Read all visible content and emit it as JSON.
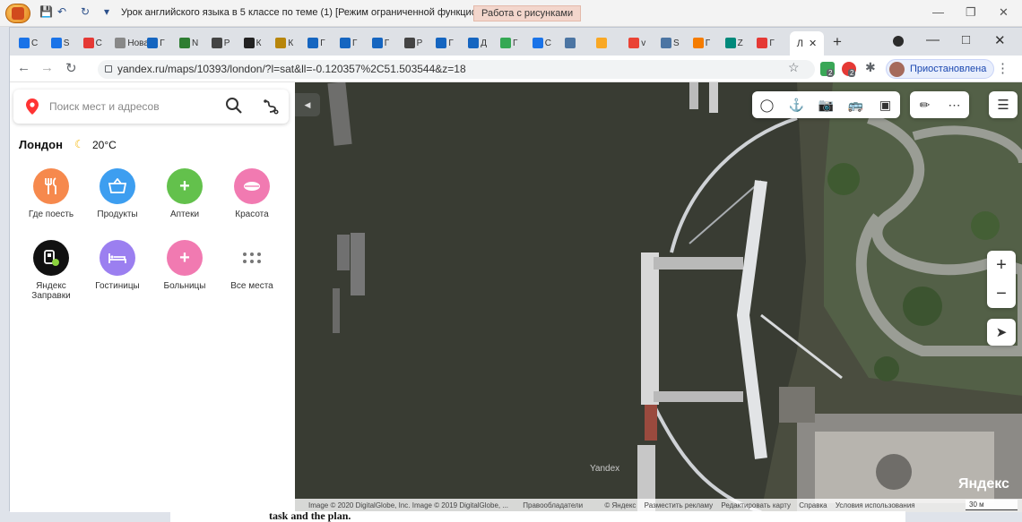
{
  "word": {
    "title": "Урок английского языка в 5 классе по теме (1) [Режим ограниченной функциона...",
    "context_tab": "Работа с рисунками",
    "doc_snippet": "task and the plan."
  },
  "browser": {
    "tabs": [
      {
        "letter": "С",
        "icon": "star-icon",
        "color": "#1a73e8"
      },
      {
        "letter": "S",
        "icon": "check-icon",
        "color": "#1a73e8"
      },
      {
        "letter": "С",
        "icon": "wheel-icon",
        "color": "#e53935"
      },
      {
        "letter": "Нова",
        "icon": "doc-icon",
        "color": "#888888"
      },
      {
        "letter": "Г",
        "icon": "mail-icon",
        "color": "#1565c0"
      },
      {
        "letter": "N",
        "icon": "eye-icon",
        "color": "#2e7d32"
      },
      {
        "letter": "Р",
        "icon": "gear-icon",
        "color": "#444444"
      },
      {
        "letter": "К",
        "icon": "wolf-icon",
        "color": "#222222"
      },
      {
        "letter": "К",
        "icon": "temple-icon",
        "color": "#b8860b"
      },
      {
        "letter": "Г",
        "icon": "p-icon",
        "color": "#1565c0"
      },
      {
        "letter": "Г",
        "icon": "mail-icon",
        "color": "#1565c0"
      },
      {
        "letter": "Г",
        "icon": "mail-icon",
        "color": "#1565c0"
      },
      {
        "letter": "Р",
        "icon": "gear-icon",
        "color": "#444444"
      },
      {
        "letter": "Г",
        "icon": "mail-icon",
        "color": "#1565c0"
      },
      {
        "letter": "Д",
        "icon": "mail-icon",
        "color": "#1565c0"
      },
      {
        "letter": "Г",
        "icon": "maps-icon",
        "color": "#34a853"
      },
      {
        "letter": "С",
        "icon": "download-icon",
        "color": "#1a73e8"
      },
      {
        "letter": "",
        "icon": "vk-icon",
        "color": "#4c75a3"
      },
      {
        "letter": "",
        "icon": "book-icon",
        "color": "#f9a825"
      },
      {
        "letter": "v",
        "icon": "google-icon",
        "color": "#ea4335"
      },
      {
        "letter": "S",
        "icon": "vk-icon",
        "color": "#4c75a3"
      },
      {
        "letter": "Г",
        "icon": "flask-icon",
        "color": "#f57c00"
      },
      {
        "letter": "Z",
        "icon": "chart-icon",
        "color": "#00897b"
      },
      {
        "letter": "Г",
        "icon": "stack-icon",
        "color": "#e53935"
      }
    ],
    "active_tab": "Л",
    "url": "yandex.ru/maps/10393/london/?l=sat&ll=-0.120357%2C51.503544&z=18",
    "profile_status": "Приостановлена",
    "ext_badges": [
      "2",
      "2"
    ]
  },
  "sidebar": {
    "search_placeholder": "Поиск мест и адресов",
    "city": "Лондон",
    "temperature": "20°C",
    "categories": [
      {
        "label": "Где поесть",
        "icon": "fork-knife-icon",
        "color": "#f6894d"
      },
      {
        "label": "Продукты",
        "icon": "basket-icon",
        "color": "#3d9ef0"
      },
      {
        "label": "Аптеки",
        "icon": "plus-icon",
        "color": "#63c14c"
      },
      {
        "label": "Красота",
        "icon": "lips-icon",
        "color": "#f17ab1"
      },
      {
        "label": "Яндекс Заправки",
        "icon": "fuel-icon",
        "color": "#111111"
      },
      {
        "label": "Гостиницы",
        "icon": "bed-icon",
        "color": "#9b7ff0"
      },
      {
        "label": "Больницы",
        "icon": "plus-icon",
        "color": "#f17ab1"
      },
      {
        "label": "Все места",
        "icon": "grid-dots-icon",
        "color": "#ffffff"
      }
    ]
  },
  "map": {
    "watermark": "Yandex",
    "logo": "Яндекс",
    "copyright_left": "Image © 2020 DigitalGlobe, Inc. Image © 2019 DigitalGlobe, ...",
    "rights": "Правообладатели",
    "footer_links": [
      "© Яндекс",
      "Разместить рекламу",
      "Редактировать карту",
      "Справка",
      "Условия использования"
    ],
    "scale": "30 м",
    "zoom_in": "+",
    "zoom_out": "−"
  }
}
